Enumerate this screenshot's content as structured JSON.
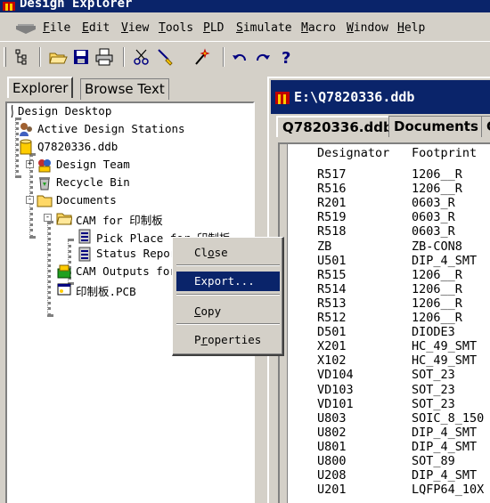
{
  "app": {
    "title": "Design Explorer"
  },
  "menubar": {
    "items": [
      "File",
      "Edit",
      "View",
      "Tools",
      "PLD",
      "Simulate",
      "Macro",
      "Window",
      "Help"
    ]
  },
  "toolbar": {
    "buttons": [
      "explorer-toggle-icon",
      "open-folder-icon",
      "save-icon",
      "print-icon",
      "scissors-icon",
      "brush-icon",
      "magic-wand-icon",
      "undo-icon",
      "redo-icon",
      "help-icon"
    ]
  },
  "explorer": {
    "tabs": [
      "Explorer",
      "Browse Text"
    ],
    "tree": [
      {
        "label": "Design Desktop",
        "icon": "desktop-root-icon"
      },
      {
        "label": "Active Design Stations",
        "icon": "stations-icon"
      },
      {
        "label": "Q7820336.ddb",
        "icon": "database-icon"
      },
      {
        "label": "Design Team",
        "icon": "team-icon",
        "expander": "+"
      },
      {
        "label": "Recycle Bin",
        "icon": "recycle-bin-icon"
      },
      {
        "label": "Documents",
        "icon": "folder-icon",
        "expander": "-"
      },
      {
        "label": "CAM for 印制板",
        "icon": "folder-open-icon",
        "expander": "-"
      },
      {
        "label": "Pick Place for 印制板",
        "icon": "cam-file-icon"
      },
      {
        "label": "Status Report",
        "icon": "cam-file-icon"
      },
      {
        "label": "CAM Outputs for",
        "icon": "cam-outputs-icon"
      },
      {
        "label": "印制板.PCB",
        "icon": "pcb-icon"
      }
    ]
  },
  "context_menu": {
    "items": [
      {
        "label": "Close",
        "mnemonic_index": 2
      },
      {
        "label": "Export...",
        "selected": true
      },
      {
        "label": "Copy",
        "mnemonic_index": 0
      },
      {
        "label": "Properties",
        "mnemonic_index": 1
      }
    ]
  },
  "document": {
    "title": "E:\\Q7820336.ddb",
    "tabs": [
      "Q7820336.ddb",
      "Documents",
      "C"
    ],
    "columns": [
      "Designator",
      "Footprint"
    ],
    "rows": [
      [
        "R517",
        "1206__R"
      ],
      [
        "R516",
        "1206__R"
      ],
      [
        "R201",
        "0603_R"
      ],
      [
        "R519",
        "0603_R"
      ],
      [
        "R518",
        "0603_R"
      ],
      [
        "ZB",
        "ZB-CON8"
      ],
      [
        "U501",
        "DIP_4_SMT"
      ],
      [
        "R515",
        "1206__R"
      ],
      [
        "R514",
        "1206__R"
      ],
      [
        "R513",
        "1206__R"
      ],
      [
        "R512",
        "1206__R"
      ],
      [
        "D501",
        "DIODE3"
      ],
      [
        "X201",
        "HC_49_SMT"
      ],
      [
        "X102",
        "HC_49_SMT"
      ],
      [
        "VD104",
        "SOT_23"
      ],
      [
        "VD103",
        "SOT_23"
      ],
      [
        "VD101",
        "SOT_23"
      ],
      [
        "U803",
        "SOIC_8_150"
      ],
      [
        "U802",
        "DIP_4_SMT"
      ],
      [
        "U801",
        "DIP_4_SMT"
      ],
      [
        "U800",
        "SOT_89"
      ],
      [
        "U208",
        "DIP_4_SMT"
      ],
      [
        "U201",
        "LQFP64_10X"
      ]
    ]
  }
}
